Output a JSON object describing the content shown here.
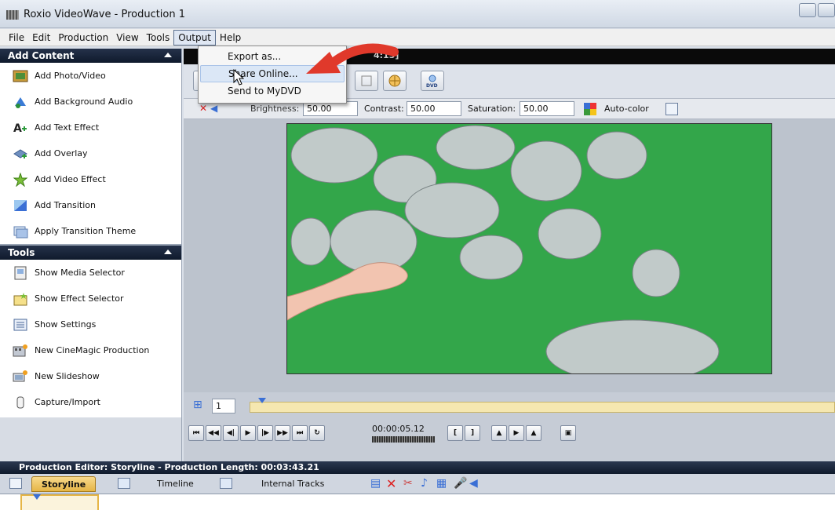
{
  "window": {
    "title": "Roxio VideoWave - Production 1"
  },
  "menu": [
    "File",
    "Edit",
    "Production",
    "View",
    "Tools",
    "Output",
    "Help"
  ],
  "output_menu": [
    "Export as...",
    "Share Online...",
    "Send to MyDVD"
  ],
  "add_content": {
    "title": "Add Content",
    "items": [
      "Add Photo/Video",
      "Add Background Audio",
      "Add Text Effect",
      "Add Overlay",
      "Add Video Effect",
      "Add Transition",
      "Apply Transition Theme"
    ]
  },
  "tools": {
    "title": "Tools",
    "items": [
      "Show Media Selector",
      "Show Effect Selector",
      "Show Settings",
      "New CineMagic Production",
      "New Slideshow",
      "Capture/Import"
    ]
  },
  "preview": {
    "header": "4:13]"
  },
  "adjust": {
    "brightness_label": "Brightness:",
    "brightness_value": "50.00",
    "contrast_label": "Contrast:",
    "contrast_value": "50.00",
    "saturation_label": "Saturation:",
    "saturation_value": "50.00",
    "autocolor_label": "Auto-color"
  },
  "playback": {
    "zoom_value": "1",
    "timecode": "00:00:05.12"
  },
  "production_editor": {
    "header": "Production Editor: Storyline - Production Length: 00:03:43.21",
    "tabs": [
      "Storyline",
      "Timeline",
      "Internal Tracks"
    ]
  },
  "colors": {
    "accent_arrow": "#e0392b",
    "panel_header": "#16223a",
    "active_tab": "#eebf55"
  }
}
